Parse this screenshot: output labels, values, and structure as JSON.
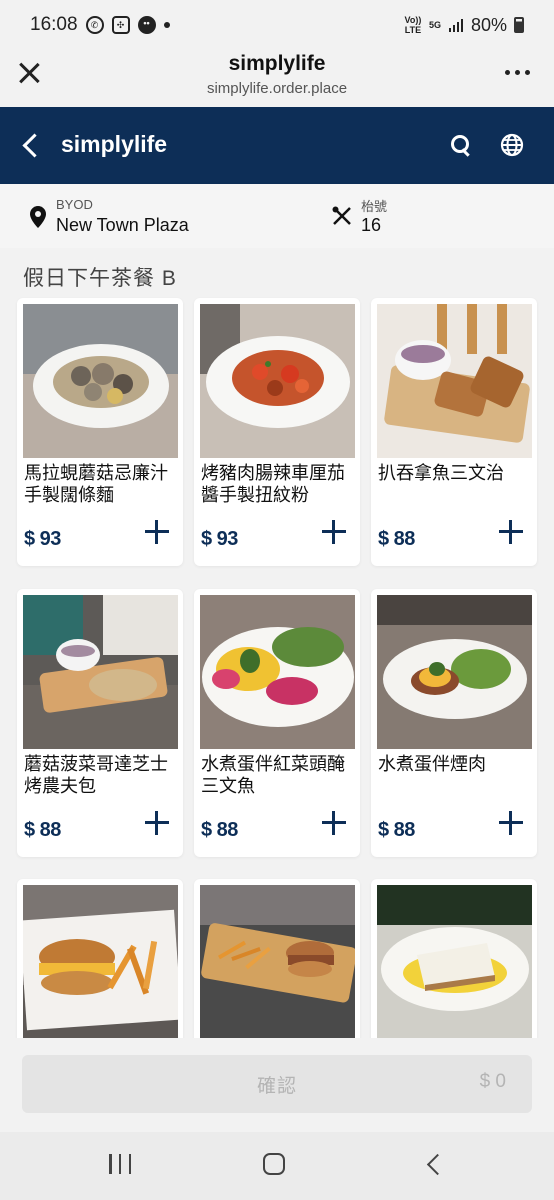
{
  "status_bar": {
    "time": "16:08",
    "network": "5G",
    "volte": "Vo)) LTE",
    "battery": "80%"
  },
  "browser": {
    "title": "simplylife",
    "url": "simplylife.order.place"
  },
  "header": {
    "name": "simplylife"
  },
  "info": {
    "mode": "BYOD",
    "store": "New Town Plaza",
    "table_label": "枱號",
    "table_number": "16"
  },
  "section_title": "假日下午茶餐 B",
  "items": [
    {
      "name": "馬拉蜆蘑菇忌廉汁手製闊條麵",
      "price": "$ 93"
    },
    {
      "name": "烤豬肉腸辣車厘茄醬手製扭紋粉",
      "price": "$ 93"
    },
    {
      "name": "扒吞拿魚三文治",
      "price": "$ 88"
    },
    {
      "name": "蘑菇菠菜哥達芝士烤農夫包",
      "price": "$ 88"
    },
    {
      "name": "水煮蛋伴紅菜頭醃三文魚",
      "price": "$ 88"
    },
    {
      "name": "水煮蛋伴煙肉",
      "price": "$ 88"
    }
  ],
  "confirm": {
    "label": "確認",
    "total": "$ 0"
  },
  "colors": {
    "brand": "#0d2e57",
    "background": "#f2f2f2"
  },
  "icons": [
    "whatsapp-icon",
    "app-icon",
    "wechat-icon",
    "signal-icon",
    "close-icon",
    "more-icon",
    "back-icon",
    "search-icon",
    "globe-icon",
    "location-pin-icon",
    "cutlery-icon",
    "plus-icon"
  ]
}
